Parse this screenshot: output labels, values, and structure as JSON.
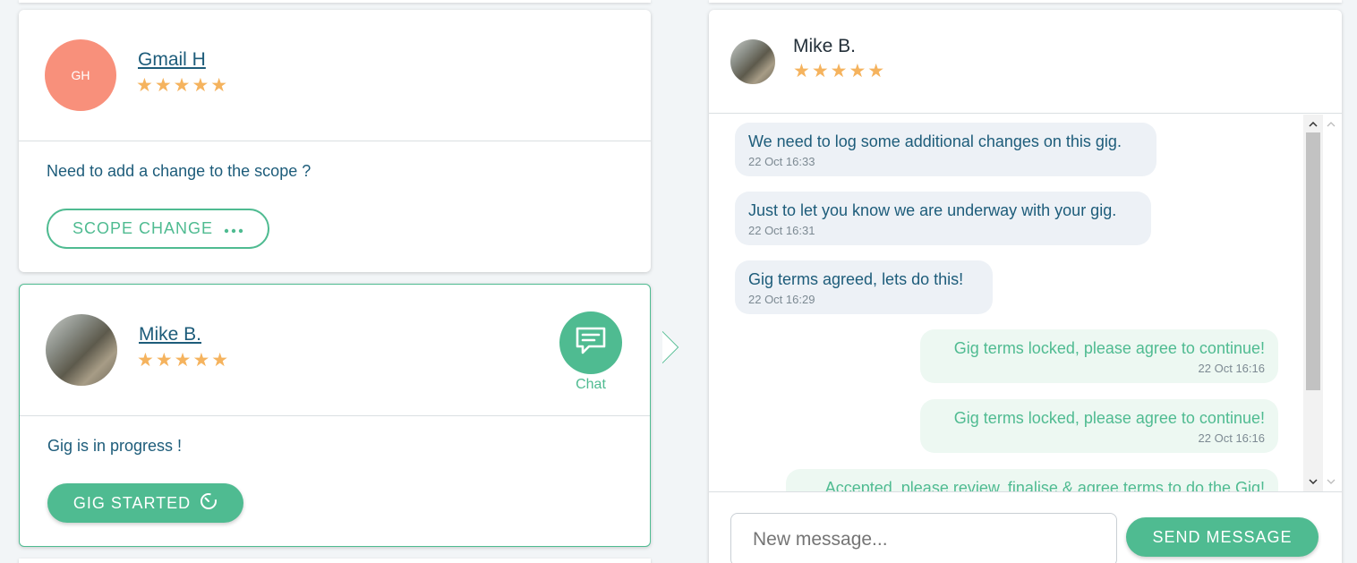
{
  "colors": {
    "accent": "#4fbb91",
    "star": "#f5b35e",
    "text": "#1d5c7a",
    "initials_bg": "#f8907b"
  },
  "cards": [
    {
      "initials": "GH",
      "name": "Gmail H",
      "rating": 5,
      "stars": "★★★★★",
      "message": "Need to add a change to the scope ?",
      "button_label": "SCOPE CHANGE",
      "button_icon": "dots-icon"
    },
    {
      "name": "Mike B.",
      "rating": 5,
      "stars": "★★★★★",
      "message": "Gig is in progress !",
      "button_label": "GIG STARTED",
      "button_icon": "timer-icon",
      "chat_label": "Chat"
    }
  ],
  "chat": {
    "contact_name": "Mike B.",
    "rating": 5,
    "stars": "★★★★★",
    "messages": [
      {
        "direction": "in",
        "text": "We need to log some additional changes on this gig.",
        "time": "22 Oct 16:33"
      },
      {
        "direction": "in",
        "text": "Just to let you know we are underway with your gig.",
        "time": "22 Oct 16:31"
      },
      {
        "direction": "in",
        "text": "Gig terms agreed, lets do this!",
        "time": "22 Oct 16:29"
      },
      {
        "direction": "out",
        "text": "Gig terms locked, please agree to continue!",
        "time": "22 Oct 16:16"
      },
      {
        "direction": "out",
        "text": "Gig terms locked, please agree to continue!",
        "time": "22 Oct 16:16"
      },
      {
        "direction": "out",
        "text": "Accepted, please review, finalise & agree terms to do the Gig!",
        "time": ""
      }
    ],
    "input_placeholder": "New message...",
    "send_label": "SEND MESSAGE"
  }
}
